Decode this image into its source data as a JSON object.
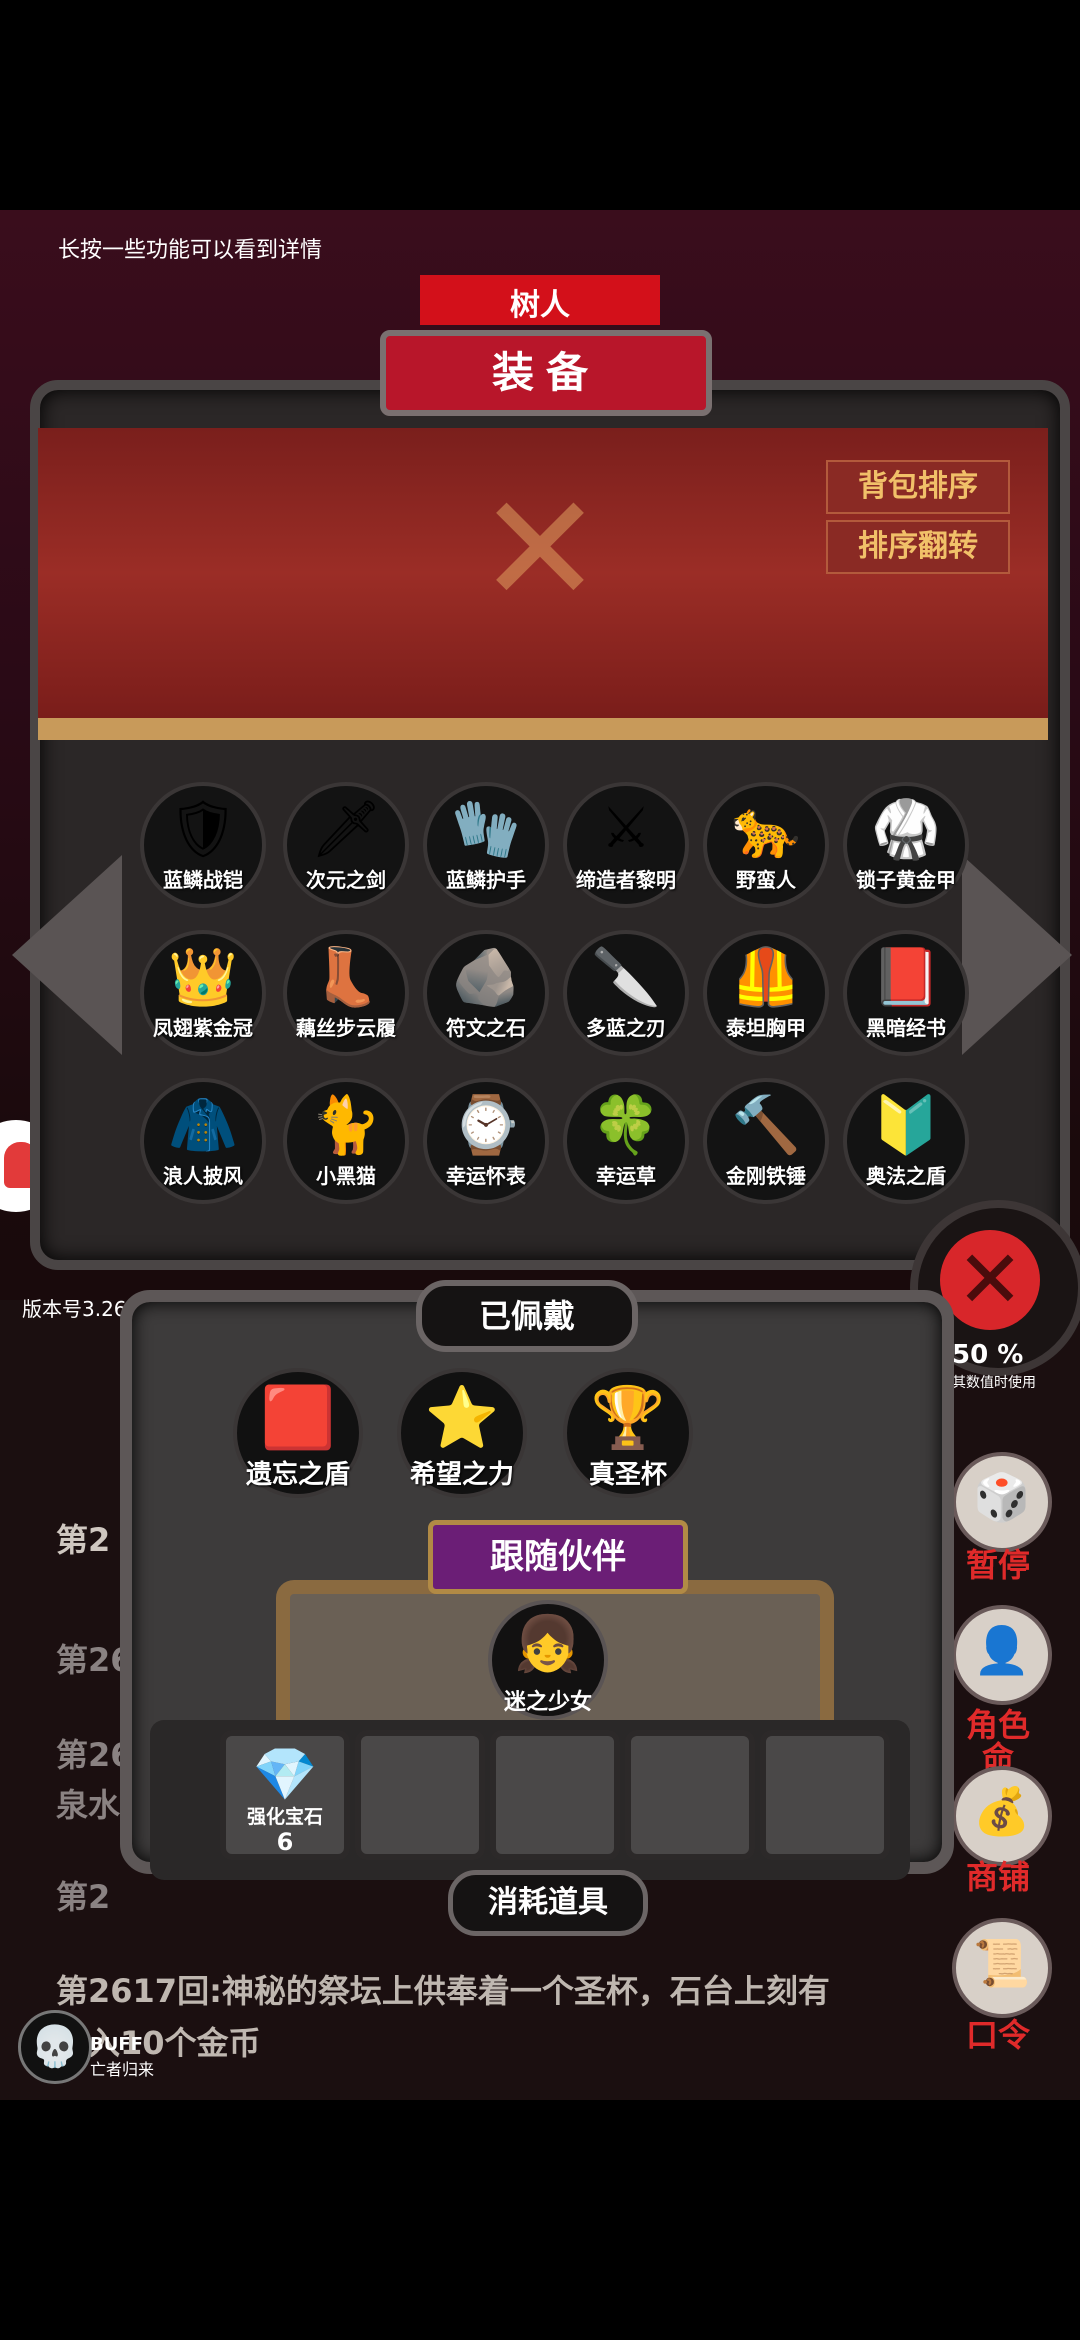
{
  "hint": "长按一些功能可以看到详情",
  "header": {
    "top_title": "树人",
    "main_title": "装备"
  },
  "sort": {
    "bag_sort": "背包排序",
    "reverse_sort": "排序翻转"
  },
  "inventory": [
    {
      "name": "蓝鳞战铠",
      "icon": "🛡"
    },
    {
      "name": "次元之剑",
      "icon": "🗡"
    },
    {
      "name": "蓝鳞护手",
      "icon": "🧤"
    },
    {
      "name": "缔造者黎明",
      "icon": "⚔"
    },
    {
      "name": "野蛮人",
      "icon": "🐆"
    },
    {
      "name": "锁子黄金甲",
      "icon": "🥋"
    },
    {
      "name": "凤翅紫金冠",
      "icon": "👑"
    },
    {
      "name": "藕丝步云履",
      "icon": "👢"
    },
    {
      "name": "符文之石",
      "icon": "🪨"
    },
    {
      "name": "多蓝之刃",
      "icon": "🔪"
    },
    {
      "name": "泰坦胸甲",
      "icon": "🦺"
    },
    {
      "name": "黑暗经书",
      "icon": "📕"
    },
    {
      "name": "浪人披风",
      "icon": "🧥"
    },
    {
      "name": "小黑猫",
      "icon": "🐈"
    },
    {
      "name": "幸运怀表",
      "icon": "⌚"
    },
    {
      "name": "幸运草",
      "icon": "🍀"
    },
    {
      "name": "金刚铁锤",
      "icon": "🔨"
    },
    {
      "name": "奥法之盾",
      "icon": "🔰"
    }
  ],
  "equipped": {
    "title": "已佩戴",
    "items": [
      {
        "name": "遗忘之盾",
        "icon": "🟥"
      },
      {
        "name": "希望之力",
        "icon": "⭐"
      },
      {
        "name": "真圣杯",
        "icon": "🏆"
      }
    ]
  },
  "companion": {
    "title": "跟随伙伴",
    "name": "迷之少女",
    "icon": "👧"
  },
  "consumables": {
    "title": "消耗道具",
    "items": [
      {
        "name": "强化宝石",
        "icon": "💎",
        "count": "6"
      }
    ]
  },
  "version": "版本号3.26",
  "log": {
    "line1": "第2",
    "line2": "第262",
    "line3": "第26",
    "line3b": "泉水",
    "line4": "第2",
    "bottom1": "第2617回:神秘的祭坛上供奉着一个圣杯，石台上刻有",
    "bottom2": "投入10个金币"
  },
  "right": {
    "stat": "50 %",
    "stat_sub": "其数值时使用",
    "pause": "暂停",
    "role": "角色",
    "role2": "命",
    "shop": "商铺",
    "password": "口令"
  },
  "buff": {
    "label": "BUFF",
    "sub": "亡者归来",
    "icon": "💀"
  }
}
